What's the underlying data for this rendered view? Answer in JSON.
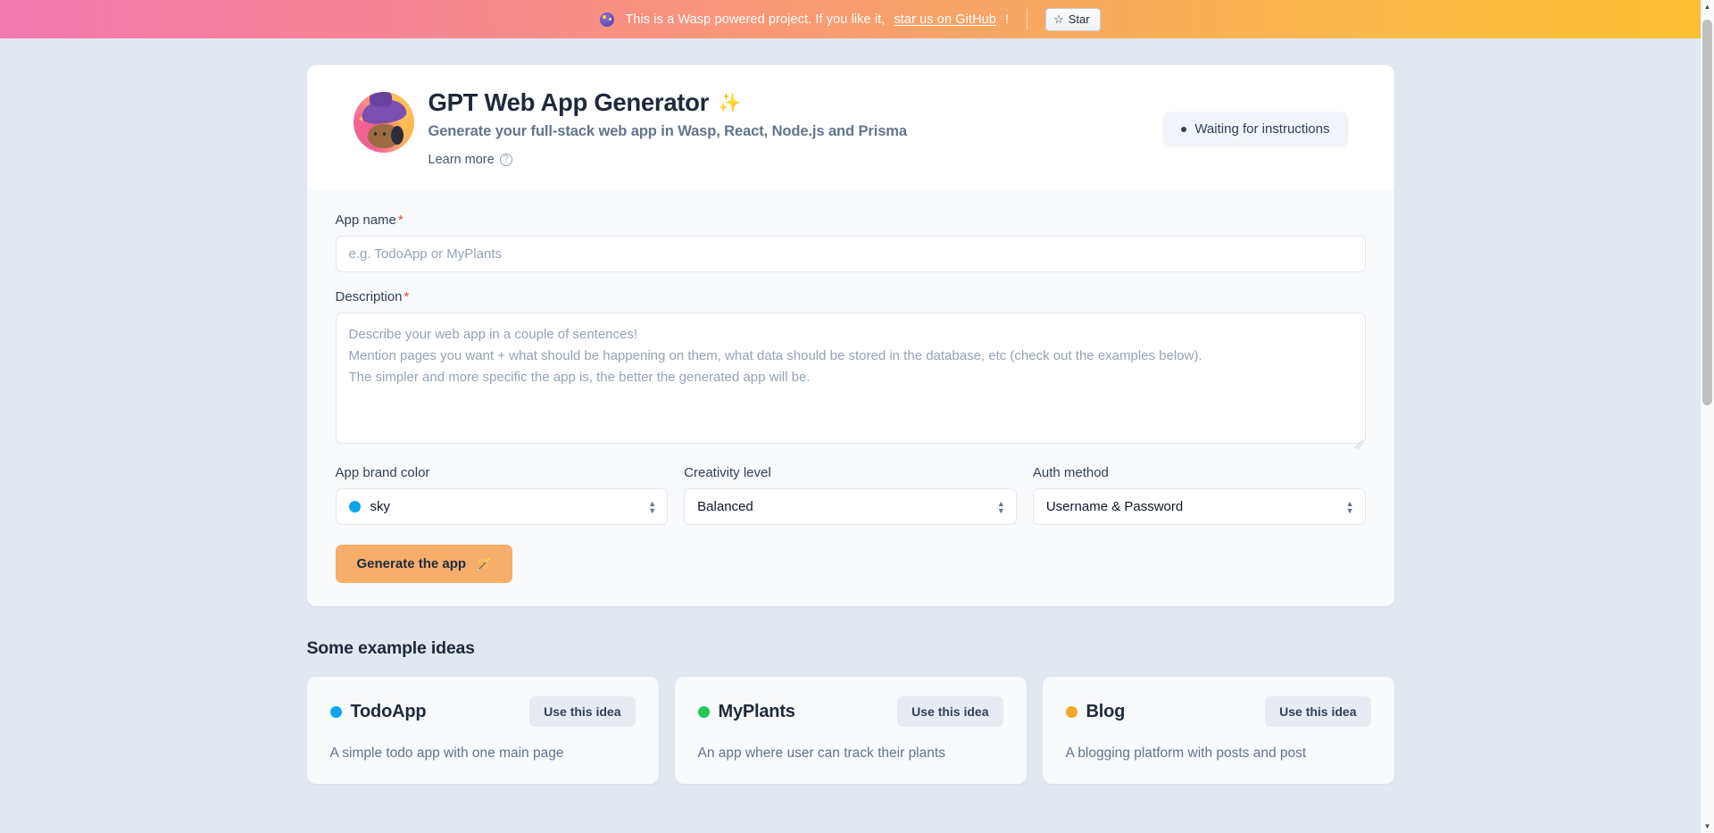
{
  "banner": {
    "icon": "wasp-bee-icon",
    "text_before": "This is a Wasp powered project. If you like it,",
    "link_text": "star us on GitHub",
    "text_after": "!",
    "star_button": {
      "icon": "star-icon",
      "glyph": "☆",
      "label": "Star"
    },
    "gradient_from": "#f279ae",
    "gradient_to": "#fbbe34"
  },
  "header": {
    "logo": "wasp-wizard-bee-logo",
    "title": "GPT Web App Generator",
    "title_emoji": "✨",
    "subtitle": "Generate your full-stack web app in Wasp, React, Node.js and Prisma",
    "learn_more": "Learn more",
    "learn_more_icon": "question-circle-icon",
    "status": {
      "label": "Waiting for instructions",
      "dot_color": "#334155"
    }
  },
  "form": {
    "app_name": {
      "label": "App name",
      "required_mark": "*",
      "value": "",
      "placeholder": "e.g. TodoApp or MyPlants"
    },
    "description": {
      "label": "Description",
      "required_mark": "*",
      "value": "",
      "placeholder": "Describe your web app in a couple of sentences!\nMention pages you want + what should be happening on them, what data should be stored in the database, etc (check out the examples below).\nThe simpler and more specific the app is, the better the generated app will be."
    },
    "brand_color": {
      "label": "App brand color",
      "selected": "sky",
      "selected_color": "#0ea5e9"
    },
    "creativity": {
      "label": "Creativity level",
      "selected": "Balanced"
    },
    "auth_method": {
      "label": "Auth method",
      "selected": "Username & Password"
    },
    "generate_button": {
      "label": "Generate the app",
      "icon": "magic-wand-icon",
      "glyph": "🪄",
      "color": "#f5af6b"
    }
  },
  "examples": {
    "title": "Some example ideas",
    "use_idea_label": "Use this idea",
    "cards": [
      {
        "name": "TodoApp",
        "dot_color": "#0ea5e9",
        "description": "A simple todo app with one main page"
      },
      {
        "name": "MyPlants",
        "dot_color": "#22c55e",
        "description": "An app where user can track their plants"
      },
      {
        "name": "Blog",
        "dot_color": "#f5a623",
        "description": "A blogging platform with posts and post"
      }
    ]
  },
  "scrollbar": {
    "up_arrow": "▲",
    "down_arrow": "▼"
  }
}
